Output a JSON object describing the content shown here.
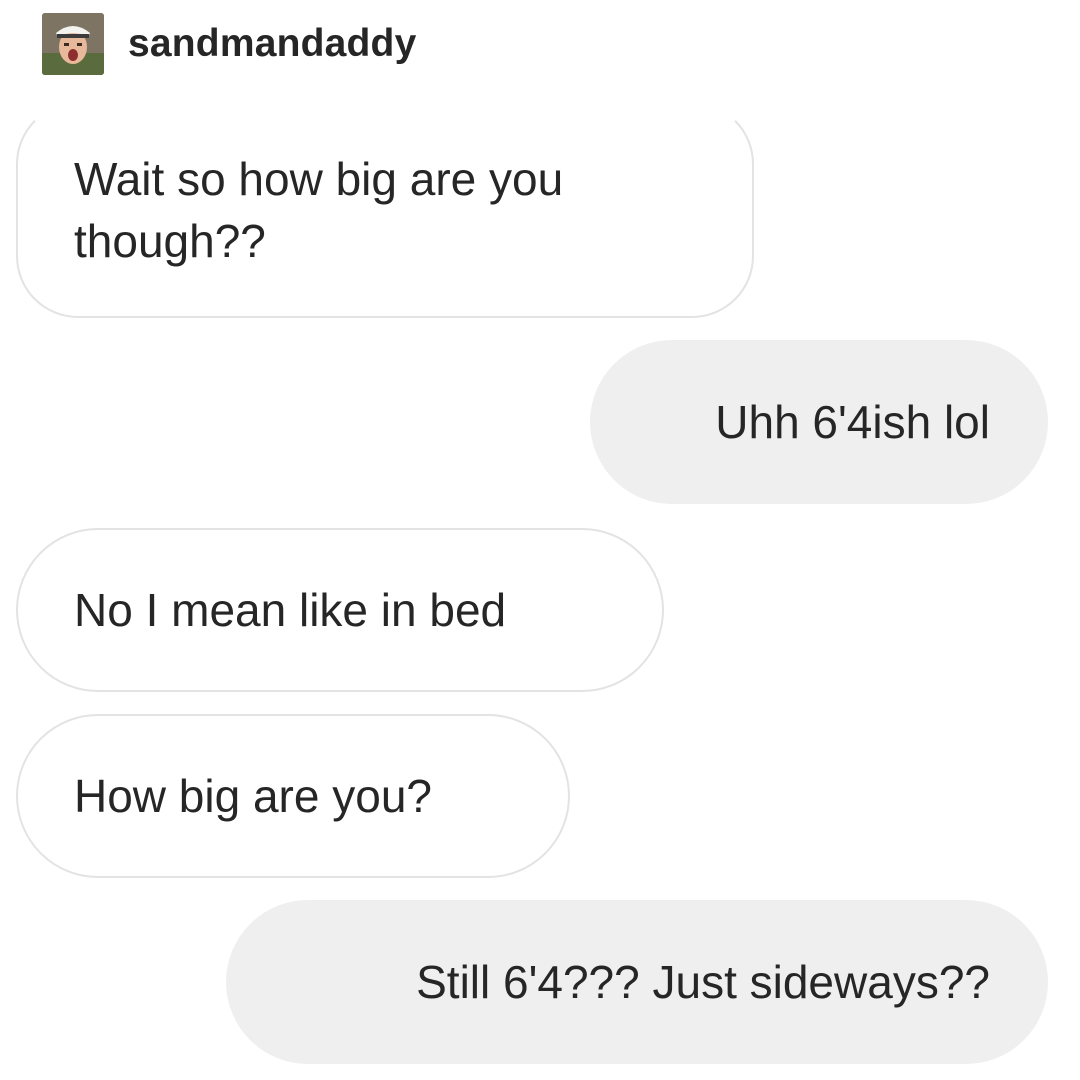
{
  "header": {
    "username": "sandmandaddy",
    "avatar_icon": "user-avatar-photo"
  },
  "messages": [
    {
      "direction": "received",
      "text": "Wait so how big are you though??"
    },
    {
      "direction": "sent",
      "text": "Uhh 6'4ish lol"
    },
    {
      "direction": "received",
      "text": "No I mean like in bed"
    },
    {
      "direction": "received",
      "text": "How big are you?"
    },
    {
      "direction": "sent",
      "text": "Still 6'4??? Just sideways??"
    }
  ],
  "colors": {
    "received_bubble_bg": "#ffffff",
    "received_bubble_border": "#e3e3e3",
    "sent_bubble_bg": "#efefef",
    "text": "#262626"
  }
}
